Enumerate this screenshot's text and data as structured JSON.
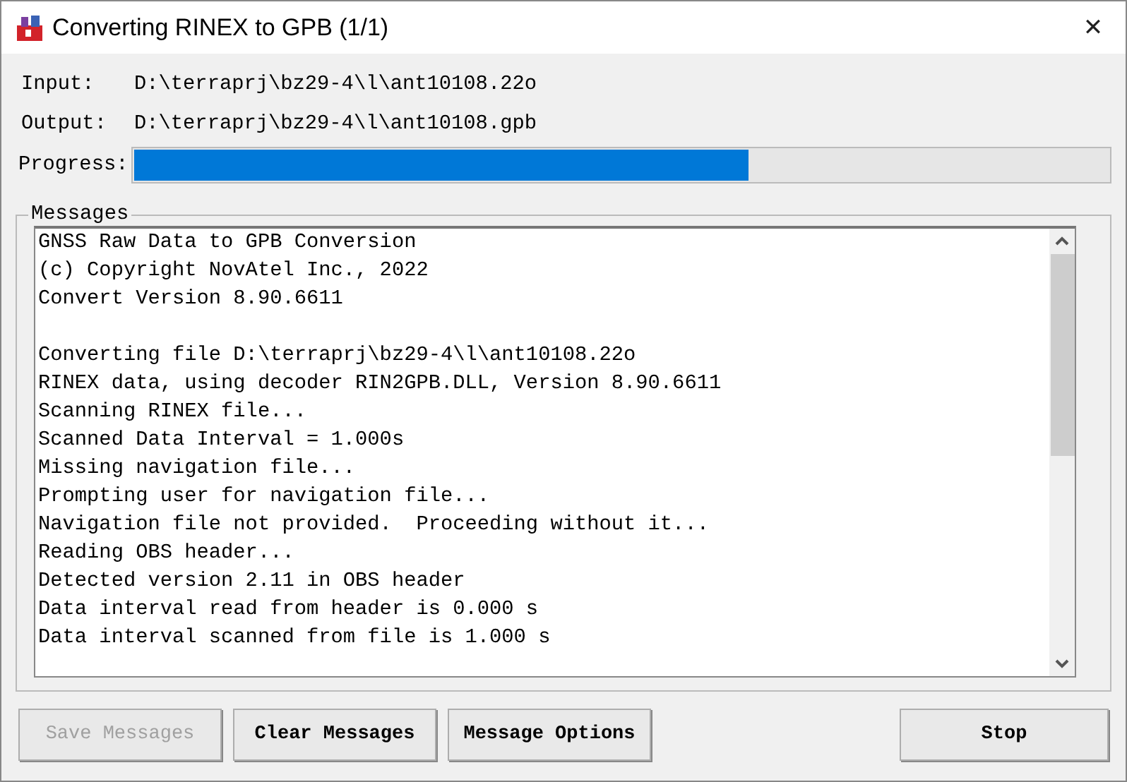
{
  "window": {
    "title": "Converting RINEX to GPB (1/1)",
    "close": "✕"
  },
  "fields": [
    {
      "label": "Input:",
      "value": "D:\\terraprj\\bz29-4\\l\\ant10108.22o"
    },
    {
      "label": "Output:",
      "value": "D:\\terraprj\\bz29-4\\l\\ant10108.gpb"
    }
  ],
  "progress": {
    "label": "Progress:",
    "level": 0.63
  },
  "messages": {
    "title": "Messages",
    "blocks": [
      [
        "GNSS Raw Data to GPB Conversion",
        "(c) Copyright NovAtel Inc., 2022",
        "Convert Version 8.90.6611"
      ],
      [
        "Converting file D:\\terraprj\\bz29-4\\l\\ant10108.22o",
        "RINEX data, using decoder RIN2GPB.DLL, Version 8.90.6611",
        "Scanning RINEX file...",
        "Scanned Data Interval = 1.000s",
        "Missing navigation file...",
        "Prompting user for navigation file...",
        "Navigation file not provided.  Proceeding without it...",
        "Reading OBS header...",
        "Detected version 2.11 in OBS header",
        "Data interval read from header is 0.000 s",
        "Data interval scanned from file is 1.000 s"
      ]
    ]
  },
  "buttons": [
    {
      "label": "Save Messages",
      "disabled": true
    },
    {
      "label": "Clear Messages",
      "disabled": false
    },
    {
      "label": "Message Options",
      "disabled": false
    },
    {
      "label": "Stop",
      "disabled": false
    }
  ]
}
